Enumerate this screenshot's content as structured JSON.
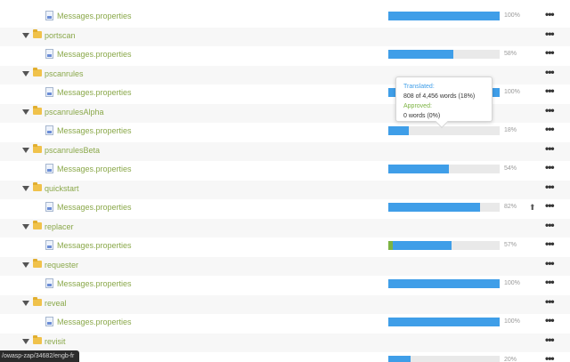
{
  "rows": [
    {
      "kind": "file",
      "name": "Messages.properties",
      "progress": 100,
      "approved": 0,
      "percent_label": "100%"
    },
    {
      "kind": "folder",
      "name": "portscan"
    },
    {
      "kind": "file",
      "name": "Messages.properties",
      "progress": 58,
      "approved": 0,
      "percent_label": "58%"
    },
    {
      "kind": "folder",
      "name": "pscanrules"
    },
    {
      "kind": "file",
      "name": "Messages.properties",
      "progress": 100,
      "approved": 0,
      "percent_label": "100%"
    },
    {
      "kind": "folder",
      "name": "pscanrulesAlpha"
    },
    {
      "kind": "file",
      "name": "Messages.properties",
      "progress": 18,
      "approved": 0,
      "percent_label": "18%"
    },
    {
      "kind": "folder",
      "name": "pscanrulesBeta"
    },
    {
      "kind": "file",
      "name": "Messages.properties",
      "progress": 54,
      "approved": 0,
      "percent_label": "54%"
    },
    {
      "kind": "folder",
      "name": "quickstart"
    },
    {
      "kind": "file",
      "name": "Messages.properties",
      "progress": 82,
      "approved": 0,
      "percent_label": "82%",
      "upload": true
    },
    {
      "kind": "folder",
      "name": "replacer"
    },
    {
      "kind": "file",
      "name": "Messages.properties",
      "progress": 57,
      "approved": 4,
      "percent_label": "57%"
    },
    {
      "kind": "folder",
      "name": "requester"
    },
    {
      "kind": "file",
      "name": "Messages.properties",
      "progress": 100,
      "approved": 0,
      "percent_label": "100%"
    },
    {
      "kind": "folder",
      "name": "reveal"
    },
    {
      "kind": "file",
      "name": "Messages.properties",
      "progress": 100,
      "approved": 0,
      "percent_label": "100%"
    },
    {
      "kind": "folder",
      "name": "revisit"
    },
    {
      "kind": "file",
      "name": "",
      "progress": 20,
      "approved": 0,
      "percent_label": "20%"
    }
  ],
  "menu_glyph": "•••",
  "upload_glyph": "⬆",
  "tooltip": {
    "translated_label": "Translated:",
    "translated_value": "808 of 4,456 words (18%)",
    "approved_label": "Approved:",
    "approved_value": "0 words (0%)"
  },
  "status_url": "/owasp-zap/34682/engb-fr",
  "colors": {
    "progress_blue": "#3f9ee8",
    "approved_green": "#7cb342",
    "name_green": "#8aa84a",
    "folder_yellow": "#f0c24b"
  }
}
